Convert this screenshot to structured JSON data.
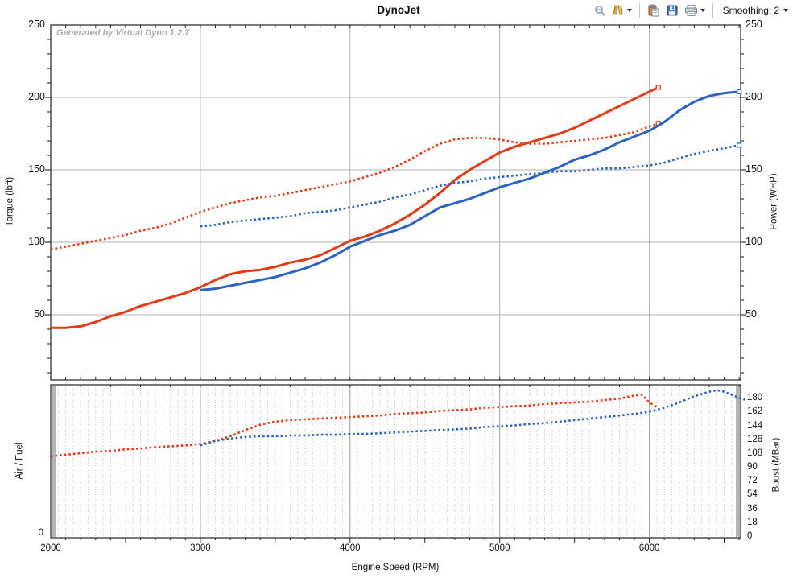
{
  "toolbar": {
    "smoothing_label": "Smoothing:",
    "smoothing_value": "2",
    "icons": [
      "zoom-icon",
      "chart-options-icon",
      "paste-icon",
      "save-icon",
      "print-icon"
    ]
  },
  "watermark": "Generated by Virtual Dyno 1.2.7",
  "chart_data": [
    {
      "type": "line",
      "title": "DynoJet",
      "xlabel": "Engine Speed (RPM)",
      "x_range": [
        2000,
        6610
      ],
      "x_ticks": [
        2000,
        3000,
        4000,
        5000,
        6000
      ],
      "grid": true,
      "left_axis": {
        "label": "Torque (lbft)",
        "range": [
          5,
          250
        ],
        "ticks": [
          250,
          200,
          150,
          100,
          50
        ]
      },
      "right_axis": {
        "label": "Power (WHP)",
        "range": [
          5,
          250
        ],
        "ticks": [
          250,
          200,
          150,
          100,
          50
        ]
      },
      "colors": {
        "red_run": "#e53a17",
        "blue_run": "#2b63c1"
      },
      "series": [
        {
          "name": "torque-red-run",
          "unit": "lbft",
          "color": "#e53a17",
          "style": "solid",
          "end_marker": true,
          "points": [
            [
              2000,
              41
            ],
            [
              2100,
              41
            ],
            [
              2200,
              42
            ],
            [
              2300,
              45
            ],
            [
              2400,
              49
            ],
            [
              2500,
              52
            ],
            [
              2600,
              56
            ],
            [
              2700,
              59
            ],
            [
              2800,
              62
            ],
            [
              2900,
              65
            ],
            [
              3000,
              69
            ],
            [
              3100,
              74
            ],
            [
              3200,
              78
            ],
            [
              3300,
              80
            ],
            [
              3400,
              81
            ],
            [
              3500,
              83
            ],
            [
              3600,
              86
            ],
            [
              3700,
              88
            ],
            [
              3800,
              91
            ],
            [
              3900,
              96
            ],
            [
              4000,
              101
            ],
            [
              4100,
              104
            ],
            [
              4200,
              108
            ],
            [
              4300,
              113
            ],
            [
              4400,
              119
            ],
            [
              4500,
              126
            ],
            [
              4600,
              134
            ],
            [
              4700,
              143
            ],
            [
              4800,
              150
            ],
            [
              4900,
              156
            ],
            [
              5000,
              162
            ],
            [
              5100,
              166
            ],
            [
              5200,
              169
            ],
            [
              5300,
              172
            ],
            [
              5400,
              175
            ],
            [
              5500,
              179
            ],
            [
              5600,
              184
            ],
            [
              5700,
              189
            ],
            [
              5800,
              194
            ],
            [
              5900,
              199
            ],
            [
              6000,
              204
            ],
            [
              6060,
              207
            ]
          ]
        },
        {
          "name": "power-red-run",
          "unit": "WHP",
          "color": "#e53a17",
          "style": "dotted",
          "end_marker": true,
          "points": [
            [
              2000,
              95
            ],
            [
              2100,
              97
            ],
            [
              2200,
              99
            ],
            [
              2300,
              101
            ],
            [
              2400,
              103
            ],
            [
              2500,
              105
            ],
            [
              2600,
              108
            ],
            [
              2700,
              110
            ],
            [
              2800,
              113
            ],
            [
              2900,
              117
            ],
            [
              3000,
              121
            ],
            [
              3100,
              124
            ],
            [
              3200,
              127
            ],
            [
              3300,
              129
            ],
            [
              3400,
              131
            ],
            [
              3500,
              132
            ],
            [
              3600,
              134
            ],
            [
              3700,
              136
            ],
            [
              3800,
              138
            ],
            [
              3900,
              140
            ],
            [
              4000,
              142
            ],
            [
              4100,
              145
            ],
            [
              4200,
              148
            ],
            [
              4300,
              152
            ],
            [
              4400,
              157
            ],
            [
              4500,
              163
            ],
            [
              4600,
              168
            ],
            [
              4700,
              171
            ],
            [
              4800,
              172
            ],
            [
              4900,
              172
            ],
            [
              5000,
              171
            ],
            [
              5100,
              169
            ],
            [
              5200,
              168
            ],
            [
              5300,
              168
            ],
            [
              5400,
              169
            ],
            [
              5500,
              170
            ],
            [
              5600,
              171
            ],
            [
              5700,
              172
            ],
            [
              5800,
              174
            ],
            [
              5900,
              176
            ],
            [
              6000,
              180
            ],
            [
              6060,
              182
            ]
          ]
        },
        {
          "name": "torque-blue-run",
          "unit": "lbft",
          "color": "#2b63c1",
          "style": "solid",
          "end_marker": true,
          "points": [
            [
              3000,
              67
            ],
            [
              3100,
              68
            ],
            [
              3200,
              70
            ],
            [
              3300,
              72
            ],
            [
              3400,
              74
            ],
            [
              3500,
              76
            ],
            [
              3600,
              79
            ],
            [
              3700,
              82
            ],
            [
              3800,
              86
            ],
            [
              3900,
              91
            ],
            [
              4000,
              97
            ],
            [
              4100,
              101
            ],
            [
              4200,
              105
            ],
            [
              4300,
              108
            ],
            [
              4400,
              112
            ],
            [
              4500,
              118
            ],
            [
              4600,
              124
            ],
            [
              4700,
              127
            ],
            [
              4800,
              130
            ],
            [
              4900,
              134
            ],
            [
              5000,
              138
            ],
            [
              5100,
              141
            ],
            [
              5200,
              144
            ],
            [
              5300,
              148
            ],
            [
              5400,
              152
            ],
            [
              5500,
              157
            ],
            [
              5600,
              160
            ],
            [
              5700,
              164
            ],
            [
              5800,
              169
            ],
            [
              5900,
              173
            ],
            [
              6000,
              177
            ],
            [
              6100,
              183
            ],
            [
              6200,
              191
            ],
            [
              6300,
              197
            ],
            [
              6400,
              201
            ],
            [
              6500,
              203
            ],
            [
              6600,
              204
            ]
          ]
        },
        {
          "name": "power-blue-run",
          "unit": "WHP",
          "color": "#2b63c1",
          "style": "dotted",
          "end_marker": true,
          "points": [
            [
              3000,
              111
            ],
            [
              3100,
              112
            ],
            [
              3200,
              114
            ],
            [
              3300,
              115
            ],
            [
              3400,
              116
            ],
            [
              3500,
              117
            ],
            [
              3600,
              118
            ],
            [
              3700,
              120
            ],
            [
              3800,
              121
            ],
            [
              3900,
              122
            ],
            [
              4000,
              124
            ],
            [
              4100,
              126
            ],
            [
              4200,
              128
            ],
            [
              4300,
              131
            ],
            [
              4400,
              133
            ],
            [
              4500,
              136
            ],
            [
              4600,
              139
            ],
            [
              4700,
              141
            ],
            [
              4800,
              142
            ],
            [
              4900,
              144
            ],
            [
              5000,
              145
            ],
            [
              5100,
              146
            ],
            [
              5200,
              147
            ],
            [
              5300,
              148
            ],
            [
              5400,
              149
            ],
            [
              5500,
              149
            ],
            [
              5600,
              150
            ],
            [
              5700,
              151
            ],
            [
              5800,
              151
            ],
            [
              5900,
              152
            ],
            [
              6000,
              153
            ],
            [
              6100,
              155
            ],
            [
              6200,
              158
            ],
            [
              6300,
              161
            ],
            [
              6400,
              163
            ],
            [
              6500,
              165
            ],
            [
              6600,
              167
            ]
          ]
        }
      ]
    },
    {
      "type": "line",
      "xlabel": "Engine Speed (RPM)",
      "x_range": [
        2000,
        6610
      ],
      "x_ticks": [
        2000,
        3000,
        4000,
        5000,
        6000
      ],
      "left_axis": {
        "label": "Air / Fuel",
        "ticks": [
          0
        ]
      },
      "right_axis": {
        "label": "Boost (MBar)",
        "range": [
          0,
          199
        ],
        "ticks": [
          180,
          162,
          144,
          126,
          108,
          90,
          72,
          54,
          36,
          18,
          0
        ]
      },
      "series": [
        {
          "name": "boost-red-run",
          "unit": "MBar",
          "color": "#e53a17",
          "style": "dotted",
          "end_marker": false,
          "points": [
            [
              2000,
              106
            ],
            [
              2100,
              108
            ],
            [
              2200,
              110
            ],
            [
              2300,
              112
            ],
            [
              2400,
              113
            ],
            [
              2500,
              115
            ],
            [
              2600,
              116
            ],
            [
              2700,
              118
            ],
            [
              2800,
              119
            ],
            [
              2900,
              120
            ],
            [
              3000,
              122
            ],
            [
              3100,
              126
            ],
            [
              3200,
              132
            ],
            [
              3300,
              140
            ],
            [
              3400,
              147
            ],
            [
              3500,
              151
            ],
            [
              3600,
              153
            ],
            [
              3700,
              154
            ],
            [
              3800,
              155
            ],
            [
              3900,
              156
            ],
            [
              4000,
              157
            ],
            [
              4100,
              158
            ],
            [
              4200,
              159
            ],
            [
              4300,
              161
            ],
            [
              4400,
              162
            ],
            [
              4500,
              163
            ],
            [
              4600,
              165
            ],
            [
              4700,
              166
            ],
            [
              4800,
              167
            ],
            [
              4900,
              169
            ],
            [
              5000,
              170
            ],
            [
              5100,
              171
            ],
            [
              5200,
              172
            ],
            [
              5300,
              174
            ],
            [
              5400,
              175
            ],
            [
              5500,
              176
            ],
            [
              5600,
              177
            ],
            [
              5700,
              179
            ],
            [
              5800,
              181
            ],
            [
              5900,
              185
            ],
            [
              5950,
              186
            ],
            [
              6000,
              176
            ],
            [
              6050,
              170
            ]
          ]
        },
        {
          "name": "boost-blue-run",
          "unit": "MBar",
          "color": "#2b63c1",
          "style": "dotted",
          "end_marker": false,
          "points": [
            [
              3000,
              120
            ],
            [
              3100,
              126
            ],
            [
              3200,
              129
            ],
            [
              3300,
              131
            ],
            [
              3400,
              132
            ],
            [
              3500,
              132
            ],
            [
              3600,
              133
            ],
            [
              3700,
              133
            ],
            [
              3800,
              134
            ],
            [
              3900,
              134
            ],
            [
              4000,
              135
            ],
            [
              4100,
              135
            ],
            [
              4200,
              136
            ],
            [
              4300,
              137
            ],
            [
              4400,
              138
            ],
            [
              4500,
              139
            ],
            [
              4600,
              140
            ],
            [
              4700,
              141
            ],
            [
              4800,
              142
            ],
            [
              4900,
              144
            ],
            [
              5000,
              145
            ],
            [
              5100,
              146
            ],
            [
              5200,
              148
            ],
            [
              5300,
              149
            ],
            [
              5400,
              151
            ],
            [
              5500,
              153
            ],
            [
              5600,
              155
            ],
            [
              5700,
              157
            ],
            [
              5800,
              159
            ],
            [
              5900,
              161
            ],
            [
              6000,
              164
            ],
            [
              6100,
              169
            ],
            [
              6200,
              176
            ],
            [
              6300,
              184
            ],
            [
              6400,
              190
            ],
            [
              6450,
              192
            ],
            [
              6500,
              190
            ],
            [
              6550,
              186
            ],
            [
              6600,
              182
            ],
            [
              6650,
              179
            ]
          ]
        }
      ]
    }
  ]
}
